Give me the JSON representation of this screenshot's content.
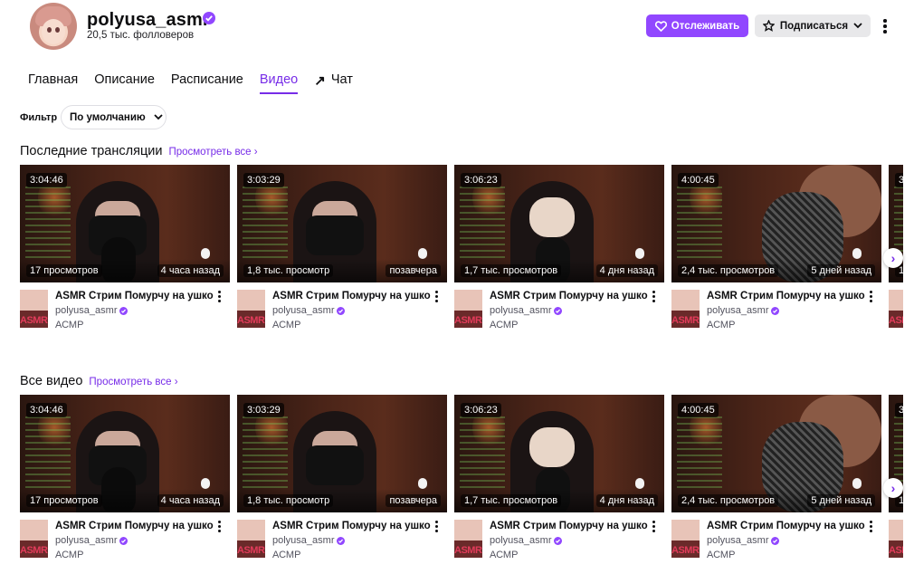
{
  "header": {
    "channel_name": "polyusa_asmr",
    "followers": "20,5 тыс. фолловеров",
    "follow_label": "Отслеживать",
    "subscribe_label": "Подписаться",
    "accent_color": "#9147ff"
  },
  "tabs": [
    {
      "label": "Главная",
      "active": false
    },
    {
      "label": "Описание",
      "active": false
    },
    {
      "label": "Расписание",
      "active": false
    },
    {
      "label": "Видео",
      "active": true
    },
    {
      "label": "Чат",
      "active": false,
      "icon": "arrow-up-right-icon"
    }
  ],
  "filter": {
    "label": "Фильтр",
    "selected": "По умолчанию"
  },
  "sections": [
    {
      "title": "Последние трансляции",
      "view_all": "Просмотреть все",
      "cards": [
        {
          "duration": "3:04:46",
          "views": "17 просмотров",
          "age": "4 часа назад",
          "title": "ASMR Стрим Помурчу на ушко",
          "channel": "polyusa_asmr",
          "category": "АСМР",
          "avatar_text": "ASMR"
        },
        {
          "duration": "3:03:29",
          "views": "1,8 тыс. просмотр",
          "age": "позавчера",
          "title": "ASMR Стрим Помурчу на ушко",
          "channel": "polyusa_asmr",
          "category": "АСМР",
          "avatar_text": "ASMR"
        },
        {
          "duration": "3:06:23",
          "views": "1,7 тыс. просмотров",
          "age": "4 дня назад",
          "title": "ASMR Стрим Помурчу на ушко",
          "channel": "polyusa_asmr",
          "category": "АСМР",
          "avatar_text": "ASMR"
        },
        {
          "duration": "4:00:45",
          "views": "2,4 тыс. просмотров",
          "age": "5 дней назад",
          "title": "ASMR Стрим Помурчу на ушко",
          "channel": "polyusa_asmr",
          "category": "АСМР",
          "avatar_text": "ASMR"
        }
      ]
    },
    {
      "title": "Все видео",
      "view_all": "Просмотреть все",
      "cards": [
        {
          "duration": "3:04:46",
          "views": "17 просмотров",
          "age": "4 часа назад",
          "title": "ASMR Стрим Помурчу на ушко",
          "channel": "polyusa_asmr",
          "category": "АСМР",
          "avatar_text": "ASMR"
        },
        {
          "duration": "3:03:29",
          "views": "1,8 тыс. просмотр",
          "age": "позавчера",
          "title": "ASMR Стрим Помурчу на ушко",
          "channel": "polyusa_asmr",
          "category": "АСМР",
          "avatar_text": "ASMR"
        },
        {
          "duration": "3:06:23",
          "views": "1,7 тыс. просмотров",
          "age": "4 дня назад",
          "title": "ASMR Стрим Помурчу на ушко",
          "channel": "polyusa_asmr",
          "category": "АСМР",
          "avatar_text": "ASMR"
        },
        {
          "duration": "4:00:45",
          "views": "2,4 тыс. просмотров",
          "age": "5 дней назад",
          "title": "ASMR Стрим Помурчу на ушко",
          "channel": "polyusa_asmr",
          "category": "АСМР",
          "avatar_text": "ASMR"
        }
      ]
    }
  ]
}
